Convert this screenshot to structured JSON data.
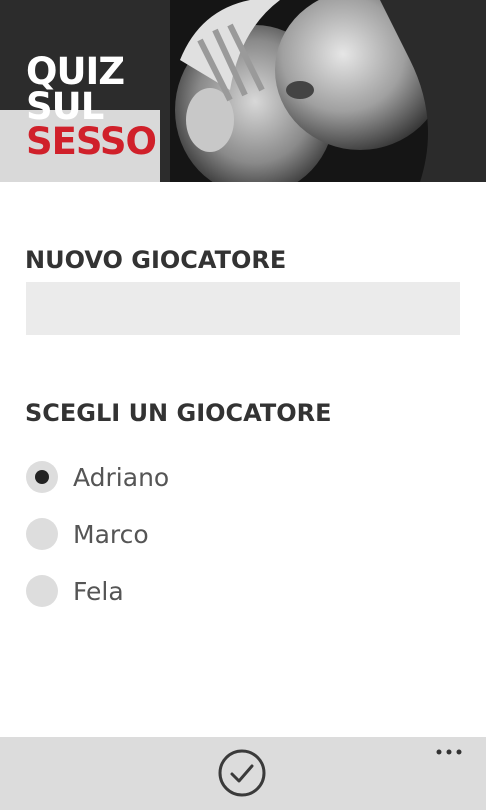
{
  "header": {
    "logo_line1": "QUIZ",
    "logo_line2": "SUL",
    "logo_line3": "SESSO",
    "logo_accent_color": "#d0202a"
  },
  "new_player": {
    "title": "NUOVO GIOCATORE",
    "input_value": ""
  },
  "choose_player": {
    "title": "SCEGLI UN GIOCATORE",
    "players": [
      {
        "label": "Adriano",
        "selected": true
      },
      {
        "label": "Marco",
        "selected": false
      },
      {
        "label": "Fela",
        "selected": false
      }
    ]
  },
  "appbar": {
    "confirm_icon": "check-circle-icon",
    "more_icon": "more-dots-icon"
  }
}
